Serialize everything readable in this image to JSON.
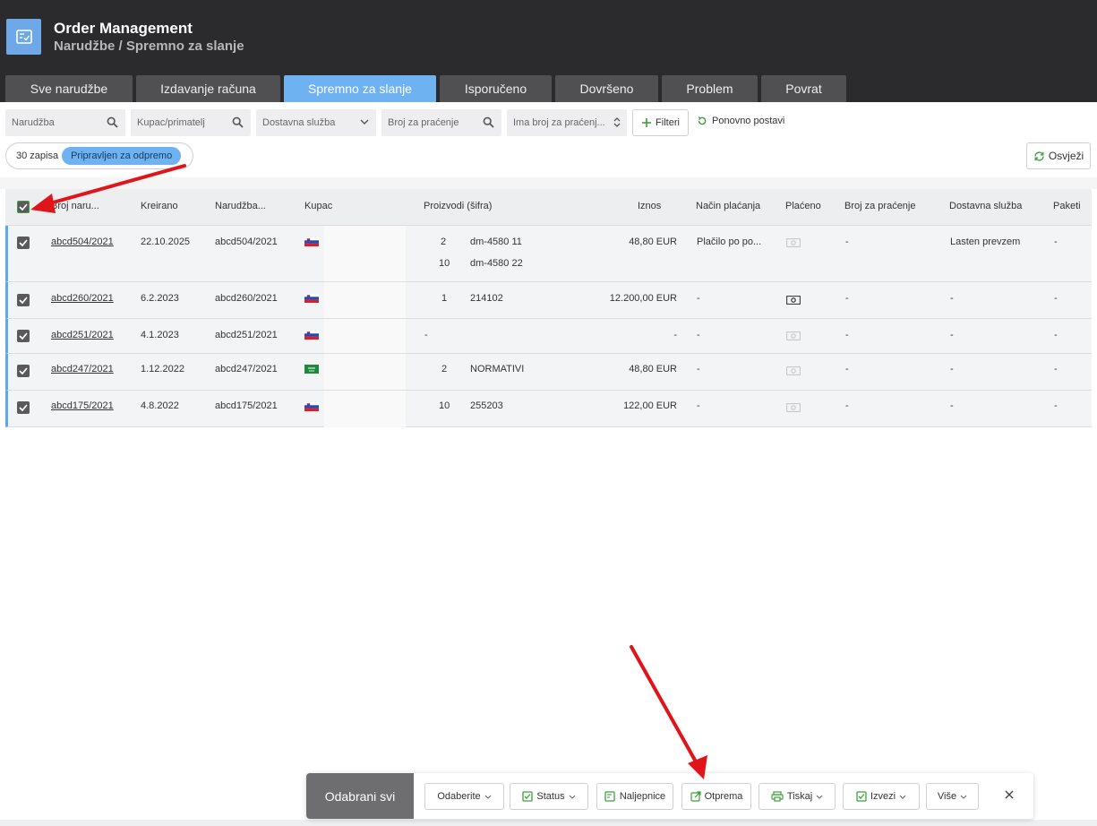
{
  "app": {
    "title": "Order Management",
    "breadcrumb": "Narudžbe / Spremno za slanje",
    "logo_icon": "checklist-icon",
    "accent": "#6fb2f2"
  },
  "tabs": [
    {
      "label": "Sve narudžbe",
      "active": false
    },
    {
      "label": "Izdavanje računa",
      "active": false
    },
    {
      "label": "Spremno za slanje",
      "active": true
    },
    {
      "label": "Isporučeno",
      "active": false
    },
    {
      "label": "Dovršeno",
      "active": false
    },
    {
      "label": "Problem",
      "active": false
    },
    {
      "label": "Povrat",
      "active": false
    }
  ],
  "filters": {
    "order_placeholder": "Narudžba",
    "customer_placeholder": "Kupac/primatelj",
    "shipping_placeholder": "Dostavna služba",
    "tracking_placeholder": "Broj za praćenje",
    "has_tracking_placeholder": "Ima broj za praćenj...",
    "filters_label": "Filteri",
    "reset_label": "Ponovno postavi",
    "count": "30 zapisa",
    "status_chip": "Pripravljen za odpremo",
    "refresh_label": "Osvježi"
  },
  "table": {
    "headers": {
      "order_no": "Broj naru...",
      "created": "Kreirano",
      "order": "Narudžba...",
      "customer": "Kupac",
      "products": "Proizvodi (šifra)",
      "amount": "Iznos",
      "payment": "Način plaćanja",
      "paid": "Plaćeno",
      "tracking": "Broj za praćenje",
      "shipping": "Dostavna služba",
      "packages": "Paketi"
    },
    "rows": [
      {
        "order_no": "abcd504/2021",
        "created": "22.10.2025",
        "order": "abcd504/2021",
        "country_flag": "slovenia-flag",
        "qty1": "2",
        "code1": "dm-4580 11",
        "qty2": "10",
        "code2": "dm-4580 22",
        "amount": "48,80 EUR",
        "payment": "Plačilo po po...",
        "paid_icon": "money-icon",
        "tracking": "-",
        "shipping": "Lasten prevzem",
        "packages": "-"
      },
      {
        "order_no": "abcd260/2021",
        "created": "6.2.2023",
        "order": "abcd260/2021",
        "country_flag": "slovenia-flag",
        "qty1": "1",
        "code1": "214102",
        "amount": "12.200,00 EUR",
        "payment": "-",
        "paid_icon": "money-icon",
        "tracking": "-",
        "shipping": "-",
        "packages": "-"
      },
      {
        "order_no": "abcd251/2021",
        "created": "4.1.2023",
        "order": "abcd251/2021",
        "country_flag": "slovenia-flag",
        "qty1": "-",
        "code1": "",
        "amount": "-",
        "payment": "-",
        "paid_icon": "money-icon",
        "tracking": "-",
        "shipping": "-",
        "packages": "-"
      },
      {
        "order_no": "abcd247/2021",
        "created": "1.12.2022",
        "order": "abcd247/2021",
        "country_flag": "saudi-arabia-flag",
        "qty1": "2",
        "code1": "NORMATIVI",
        "amount": "48,80 EUR",
        "payment": "-",
        "paid_icon": "money-icon",
        "tracking": "-",
        "shipping": "-",
        "packages": "-"
      },
      {
        "order_no": "abcd175/2021",
        "created": "4.8.2022",
        "order": "abcd175/2021",
        "country_flag": "slovenia-flag",
        "qty1": "10",
        "code1": "255203",
        "amount": "122,00 EUR",
        "payment": "-",
        "paid_icon": "money-icon",
        "tracking": "-",
        "shipping": "-",
        "packages": "-"
      }
    ]
  },
  "actionbar": {
    "selected_label": "Odabrani svi",
    "select_label": "Odaberite",
    "status_label": "Status",
    "labels_label": "Naljepnice",
    "dispatch_label": "Otprema",
    "print_label": "Tiskaj",
    "export_label": "Izvezi",
    "more_label": "Više",
    "close_icon": "close-icon"
  }
}
